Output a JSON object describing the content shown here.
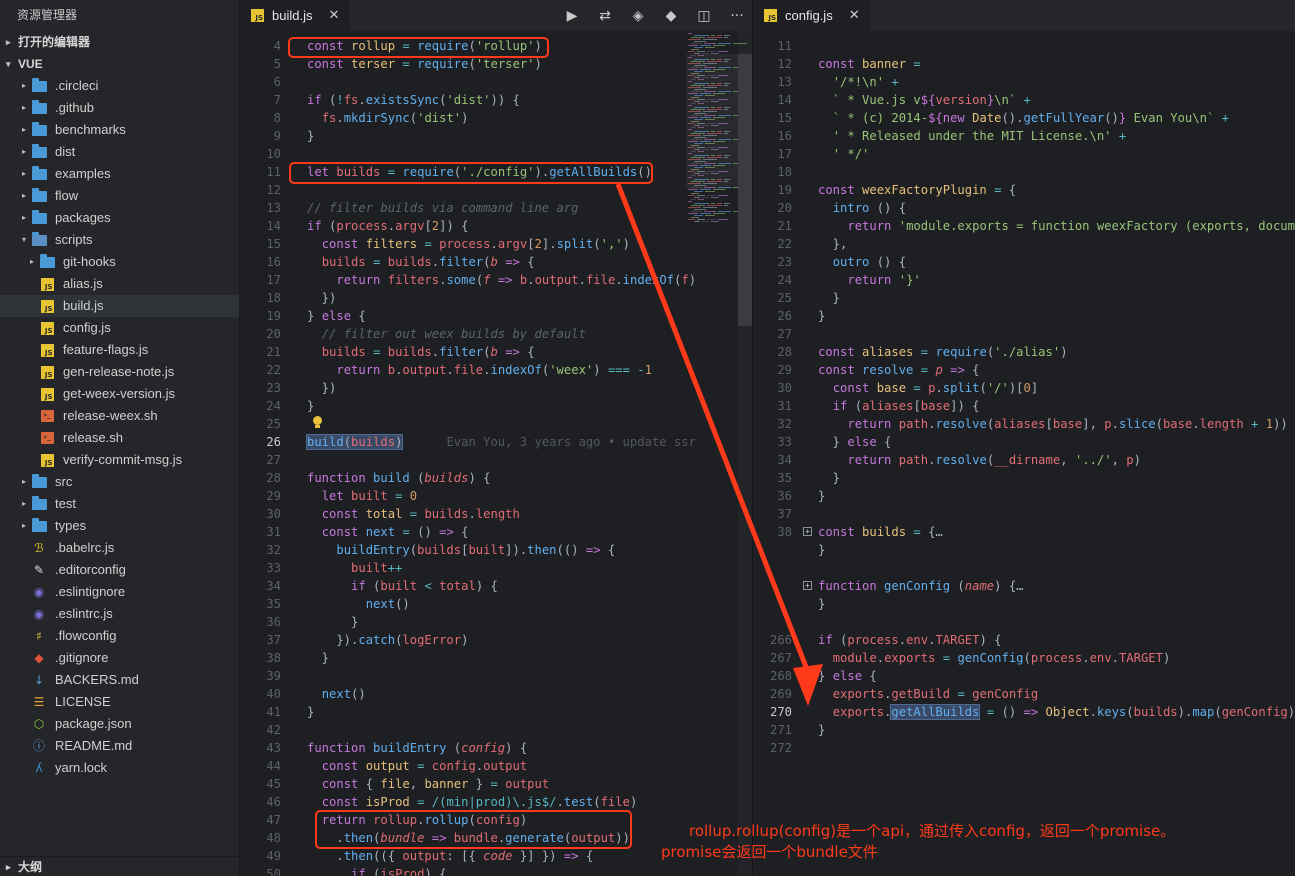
{
  "sidebar": {
    "title": "资源管理器",
    "open_editors": "打开的编辑器",
    "project": "VUE",
    "outline": "大纲",
    "items": [
      {
        "label": ".circleci",
        "kind": "folder",
        "depth": 1,
        "twisty": "▸"
      },
      {
        "label": ".github",
        "kind": "folder",
        "depth": 1,
        "twisty": "▸"
      },
      {
        "label": "benchmarks",
        "kind": "folder",
        "depth": 1,
        "twisty": "▸"
      },
      {
        "label": "dist",
        "kind": "folder",
        "depth": 1,
        "twisty": "▸"
      },
      {
        "label": "examples",
        "kind": "folder",
        "depth": 1,
        "twisty": "▸"
      },
      {
        "label": "flow",
        "kind": "folder",
        "depth": 1,
        "twisty": "▸"
      },
      {
        "label": "packages",
        "kind": "folder",
        "depth": 1,
        "twisty": "▸"
      },
      {
        "label": "scripts",
        "kind": "folder-open",
        "depth": 1,
        "twisty": "▾"
      },
      {
        "label": "git-hooks",
        "kind": "folder",
        "depth": 2,
        "twisty": "▸"
      },
      {
        "label": "alias.js",
        "kind": "js",
        "depth": 2,
        "twisty": ""
      },
      {
        "label": "build.js",
        "kind": "js",
        "depth": 2,
        "twisty": "",
        "active": true
      },
      {
        "label": "config.js",
        "kind": "js",
        "depth": 2,
        "twisty": ""
      },
      {
        "label": "feature-flags.js",
        "kind": "js",
        "depth": 2,
        "twisty": ""
      },
      {
        "label": "gen-release-note.js",
        "kind": "js",
        "depth": 2,
        "twisty": ""
      },
      {
        "label": "get-weex-version.js",
        "kind": "js",
        "depth": 2,
        "twisty": ""
      },
      {
        "label": "release-weex.sh",
        "kind": "sh",
        "depth": 2,
        "twisty": ""
      },
      {
        "label": "release.sh",
        "kind": "sh",
        "depth": 2,
        "twisty": ""
      },
      {
        "label": "verify-commit-msg.js",
        "kind": "js",
        "depth": 2,
        "twisty": ""
      },
      {
        "label": "src",
        "kind": "folder",
        "depth": 1,
        "twisty": "▸"
      },
      {
        "label": "test",
        "kind": "folder",
        "depth": 1,
        "twisty": "▸"
      },
      {
        "label": "types",
        "kind": "folder",
        "depth": 1,
        "twisty": "▸"
      },
      {
        "label": ".babelrc.js",
        "kind": "babel",
        "depth": 1,
        "twisty": ""
      },
      {
        "label": ".editorconfig",
        "kind": "editorconfig",
        "depth": 1,
        "twisty": ""
      },
      {
        "label": ".eslintignore",
        "kind": "eslint",
        "depth": 1,
        "twisty": ""
      },
      {
        "label": ".eslintrc.js",
        "kind": "eslint",
        "depth": 1,
        "twisty": ""
      },
      {
        "label": ".flowconfig",
        "kind": "flow",
        "depth": 1,
        "twisty": ""
      },
      {
        "label": ".gitignore",
        "kind": "git",
        "depth": 1,
        "twisty": ""
      },
      {
        "label": "BACKERS.md",
        "kind": "md",
        "depth": 1,
        "twisty": ""
      },
      {
        "label": "LICENSE",
        "kind": "license",
        "depth": 1,
        "twisty": ""
      },
      {
        "label": "package.json",
        "kind": "node",
        "depth": 1,
        "twisty": ""
      },
      {
        "label": "README.md",
        "kind": "info",
        "depth": 1,
        "twisty": ""
      },
      {
        "label": "yarn.lock",
        "kind": "yarn",
        "depth": 1,
        "twisty": ""
      }
    ]
  },
  "editor_left": {
    "tab_label": "build.js",
    "tab_icon": "js-file-icon",
    "toolbar_icons": [
      "run-icon",
      "compare-changes-icon",
      "open-changes-icon",
      "git-lens-icon",
      "split-editor-icon",
      "more-actions-icon"
    ],
    "lines": [
      {
        "n": "4",
        "html": "<span class='k'>const</span> <span class='v'>rollup</span> <span class='op'>=</span> <span class='f'>require</span>(<span class='s'>'rollup'</span>)"
      },
      {
        "n": "5",
        "html": "<span class='k'>const</span> <span class='v'>terser</span> <span class='op'>=</span> <span class='f'>require</span>(<span class='s'>'terser'</span>)"
      },
      {
        "n": "6",
        "html": ""
      },
      {
        "n": "7",
        "html": "<span class='k'>if</span> (<span class='op'>!</span><span class='p'>fs</span>.<span class='f'>existsSync</span>(<span class='s'>'dist'</span>)) {"
      },
      {
        "n": "8",
        "html": "  <span class='p'>fs</span>.<span class='f'>mkdirSync</span>(<span class='s'>'dist'</span>)"
      },
      {
        "n": "9",
        "html": "}"
      },
      {
        "n": "10",
        "html": ""
      },
      {
        "n": "11",
        "html": "<span class='k'>let</span> <span class='p'>builds</span> <span class='op'>=</span> <span class='f'>require</span>(<span class='s'>'./config'</span>).<span class='f'>getAllBuilds</span>()"
      },
      {
        "n": "12",
        "html": ""
      },
      {
        "n": "13",
        "html": "<span class='c'>// filter builds via command line arg</span>"
      },
      {
        "n": "14",
        "html": "<span class='k'>if</span> (<span class='p'>process</span>.<span class='p'>argv</span>[<span class='n'>2</span>]) {"
      },
      {
        "n": "15",
        "html": "  <span class='k'>const</span> <span class='v'>filters</span> <span class='op'>=</span> <span class='p'>process</span>.<span class='p'>argv</span>[<span class='n'>2</span>].<span class='f'>split</span>(<span class='s'>','</span>)"
      },
      {
        "n": "16",
        "html": "  <span class='p'>builds</span> <span class='op'>=</span> <span class='p'>builds</span>.<span class='f'>filter</span>(<span class='pi'>b</span> <span class='k'>=&gt;</span> {"
      },
      {
        "n": "17",
        "html": "    <span class='k'>return</span> <span class='p'>filters</span>.<span class='f'>some</span>(<span class='pi'>f</span> <span class='k'>=&gt;</span> <span class='p'>b</span>.<span class='p'>output</span>.<span class='p'>file</span>.<span class='f'>indexOf</span>(<span class='p'>f</span>)"
      },
      {
        "n": "18",
        "html": "  })"
      },
      {
        "n": "19",
        "html": "} <span class='k'>else</span> {"
      },
      {
        "n": "20",
        "html": "  <span class='c'>// filter out weex builds by default</span>"
      },
      {
        "n": "21",
        "html": "  <span class='p'>builds</span> <span class='op'>=</span> <span class='p'>builds</span>.<span class='f'>filter</span>(<span class='pi'>b</span> <span class='k'>=&gt;</span> {"
      },
      {
        "n": "22",
        "html": "    <span class='k'>return</span> <span class='p'>b</span>.<span class='p'>output</span>.<span class='p'>file</span>.<span class='f'>indexOf</span>(<span class='s'>'weex'</span>) <span class='op'>===</span> <span class='op'>-</span><span class='n'>1</span>"
      },
      {
        "n": "23",
        "html": "  })"
      },
      {
        "n": "24",
        "html": "}"
      },
      {
        "n": "25",
        "html": ""
      },
      {
        "n": "26",
        "html": "<span class='sel'><span class='f'>build</span>(<span class='p'>builds</span>)</span>      <span class='blame'>Evan You, 3 years ago • update ssr</span>",
        "current": true
      },
      {
        "n": "27",
        "html": ""
      },
      {
        "n": "28",
        "html": "<span class='k'>function</span> <span class='f'>build</span> (<span class='pi'>builds</span>) {"
      },
      {
        "n": "29",
        "html": "  <span class='k'>let</span> <span class='p'>built</span> <span class='op'>=</span> <span class='n'>0</span>"
      },
      {
        "n": "30",
        "html": "  <span class='k'>const</span> <span class='v'>total</span> <span class='op'>=</span> <span class='p'>builds</span>.<span class='p'>length</span>"
      },
      {
        "n": "31",
        "html": "  <span class='k'>const</span> <span class='f'>next</span> <span class='op'>=</span> () <span class='k'>=&gt;</span> {"
      },
      {
        "n": "32",
        "html": "    <span class='f'>buildEntry</span>(<span class='p'>builds</span>[<span class='p'>built</span>]).<span class='f'>then</span>(() <span class='k'>=&gt;</span> {"
      },
      {
        "n": "33",
        "html": "      <span class='p'>built</span><span class='op'>++</span>"
      },
      {
        "n": "34",
        "html": "      <span class='k'>if</span> (<span class='p'>built</span> <span class='op'>&lt;</span> <span class='p'>total</span>) {"
      },
      {
        "n": "35",
        "html": "        <span class='f'>next</span>()"
      },
      {
        "n": "36",
        "html": "      }"
      },
      {
        "n": "37",
        "html": "    }).<span class='f'>catch</span>(<span class='p'>logError</span>)"
      },
      {
        "n": "38",
        "html": "  }"
      },
      {
        "n": "39",
        "html": ""
      },
      {
        "n": "40",
        "html": "  <span class='f'>next</span>()"
      },
      {
        "n": "41",
        "html": "}"
      },
      {
        "n": "42",
        "html": ""
      },
      {
        "n": "43",
        "html": "<span class='k'>function</span> <span class='f'>buildEntry</span> (<span class='pi'>config</span>) {"
      },
      {
        "n": "44",
        "html": "  <span class='k'>const</span> <span class='v'>output</span> <span class='op'>=</span> <span class='p'>config</span>.<span class='p'>output</span>"
      },
      {
        "n": "45",
        "html": "  <span class='k'>const</span> { <span class='v'>file</span>, <span class='v'>banner</span> } <span class='op'>=</span> <span class='p'>output</span>"
      },
      {
        "n": "46",
        "html": "  <span class='k'>const</span> <span class='v'>isProd</span> <span class='op'>=</span> <span class='t'>/(min|prod)\\.js$/</span>.<span class='f'>test</span>(<span class='p'>file</span>)"
      },
      {
        "n": "47",
        "html": "  <span class='k'>return</span> <span class='p'>rollup</span>.<span class='f'>rollup</span>(<span class='p'>config</span>)"
      },
      {
        "n": "48",
        "html": "    .<span class='f'>then</span>(<span class='pi'>bundle</span> <span class='k'>=&gt;</span> <span class='p'>bundle</span>.<span class='f'>generate</span>(<span class='p'>output</span>))"
      },
      {
        "n": "49",
        "html": "    .<span class='f'>then</span>(({ <span class='p'>output</span>: [{ <span class='pi'>code</span> }] }) <span class='k'>=&gt;</span> {"
      },
      {
        "n": "50",
        "html": "      <span class='k'>if</span> (<span class='p'>isProd</span>) {"
      }
    ]
  },
  "editor_right": {
    "tab_label": "config.js",
    "tab_icon": "js-file-icon",
    "lines": [
      {
        "n": "11",
        "html": ""
      },
      {
        "n": "12",
        "html": "<span class='k'>const</span> <span class='v'>banner</span> <span class='op'>=</span>"
      },
      {
        "n": "13",
        "html": "  <span class='s'>'/*!\\n' </span><span class='op'>+</span>"
      },
      {
        "n": "14",
        "html": "  <span class='s'>` * Vue.js v</span><span class='k'>${</span><span class='p'>version</span><span class='k'>}</span><span class='s'>\\n` </span><span class='op'>+</span>"
      },
      {
        "n": "15",
        "html": "  <span class='s'>` * (c) 2014-</span><span class='k'>${new</span> <span class='v'>Date</span>().<span class='f'>getFullYear</span>()<span class='k'>}</span><span class='s'> Evan You\\n` </span><span class='op'>+</span>"
      },
      {
        "n": "16",
        "html": "  <span class='s'>' * Released under the MIT License.\\n' </span><span class='op'>+</span>"
      },
      {
        "n": "17",
        "html": "  <span class='s'>' */'</span>"
      },
      {
        "n": "18",
        "html": ""
      },
      {
        "n": "19",
        "html": "<span class='k'>const</span> <span class='v'>weexFactoryPlugin</span> <span class='op'>=</span> {"
      },
      {
        "n": "20",
        "html": "  <span class='f'>intro</span> () {"
      },
      {
        "n": "21",
        "html": "    <span class='k'>return</span> <span class='s'>'module.exports = function weexFactory (exports, docume</span>"
      },
      {
        "n": "22",
        "html": "  },"
      },
      {
        "n": "23",
        "html": "  <span class='f'>outro</span> () {"
      },
      {
        "n": "24",
        "html": "    <span class='k'>return</span> <span class='s'>'}'</span>"
      },
      {
        "n": "25",
        "html": "  }"
      },
      {
        "n": "26",
        "html": "}"
      },
      {
        "n": "27",
        "html": ""
      },
      {
        "n": "28",
        "html": "<span class='k'>const</span> <span class='v'>aliases</span> <span class='op'>=</span> <span class='f'>require</span>(<span class='s'>'./alias'</span>)"
      },
      {
        "n": "29",
        "html": "<span class='k'>const</span> <span class='f'>resolve</span> <span class='op'>=</span> <span class='pi'>p</span> <span class='k'>=&gt;</span> {"
      },
      {
        "n": "30",
        "html": "  <span class='k'>const</span> <span class='v'>base</span> <span class='op'>=</span> <span class='p'>p</span>.<span class='f'>split</span>(<span class='s'>'/'</span>)[<span class='n'>0</span>]"
      },
      {
        "n": "31",
        "html": "  <span class='k'>if</span> (<span class='p'>aliases</span>[<span class='p'>base</span>]) {"
      },
      {
        "n": "32",
        "html": "    <span class='k'>return</span> <span class='p'>path</span>.<span class='f'>resolve</span>(<span class='p'>aliases</span>[<span class='p'>base</span>], <span class='p'>p</span>.<span class='f'>slice</span>(<span class='p'>base</span>.<span class='p'>length</span> <span class='op'>+</span> <span class='n'>1</span>))"
      },
      {
        "n": "33",
        "html": "  } <span class='k'>else</span> {"
      },
      {
        "n": "34",
        "html": "    <span class='k'>return</span> <span class='p'>path</span>.<span class='f'>resolve</span>(<span class='p'>__dirname</span>, <span class='s'>'../'</span>, <span class='p'>p</span>)"
      },
      {
        "n": "35",
        "html": "  }"
      },
      {
        "n": "36",
        "html": "}"
      },
      {
        "n": "37",
        "html": ""
      },
      {
        "n": "38",
        "html": "<span class='k'>const</span> <span class='v'>builds</span> <span class='op'>=</span> {…",
        "fold": true
      },
      {
        "n": "",
        "html": "}"
      },
      {
        "n": "",
        "html": ""
      },
      {
        "n": "",
        "html": "<span class='k'>function</span> <span class='f'>genConfig</span> (<span class='pi'>name</span>) {…",
        "fold": true
      },
      {
        "n": "",
        "html": "}"
      },
      {
        "n": "",
        "html": ""
      },
      {
        "n": "266",
        "html": "<span class='k'>if</span> (<span class='p'>process</span>.<span class='p'>env</span>.<span class='p'>TARGET</span>) {"
      },
      {
        "n": "267",
        "html": "  <span class='p'>module</span>.<span class='p'>exports</span> <span class='op'>=</span> <span class='f'>genConfig</span>(<span class='p'>process</span>.<span class='p'>env</span>.<span class='p'>TARGET</span>)"
      },
      {
        "n": "268",
        "html": "} <span class='k'>else</span> {"
      },
      {
        "n": "269",
        "html": "  <span class='p'>exports</span>.<span class='p'>getBuild</span> <span class='op'>=</span> <span class='p'>genConfig</span>"
      },
      {
        "n": "270",
        "html": "  <span class='p'>exports</span>.<span class='sel'><span class='f'>getAllBuilds</span></span> <span class='op'>=</span> () <span class='k'>=&gt;</span> <span class='v'>Object</span>.<span class='f'>keys</span>(<span class='p'>builds</span>).<span class='f'>map</span>(<span class='p'>genConfig</span>)",
        "current": true
      },
      {
        "n": "271",
        "html": "}"
      },
      {
        "n": "272",
        "html": ""
      }
    ]
  },
  "annotation": {
    "color": "#ff3a1a",
    "line1": "rollup.rollup(config)是一个api，通过传入config，返回一个promise。",
    "line2": "promise会返回一个bundle文件"
  }
}
